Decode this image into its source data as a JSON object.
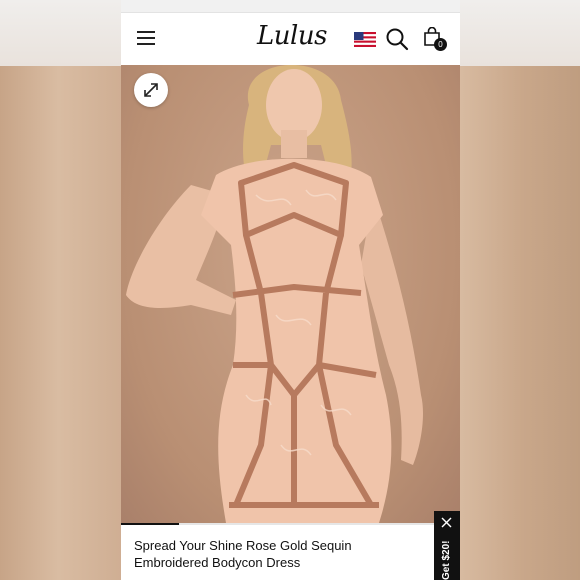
{
  "header": {
    "logo_text": "Lulus",
    "bag_count": "0",
    "icons": [
      "menu-icon",
      "us-flag-icon",
      "search-icon",
      "shopping-bag-icon"
    ]
  },
  "hero": {
    "image_description_icon": "expand-icon",
    "carousel_progress": 0.17
  },
  "product": {
    "title_line1": "Spread Your Shine Rose Gold Sequin",
    "title_line2": "Embroidered Bodycon Dress"
  },
  "promo": {
    "label": "Get $20!"
  },
  "colors": {
    "accent": "#111111",
    "hero_background": "#b98f73",
    "dress": "#f0c4aa",
    "sequin": "#b77a5e"
  }
}
